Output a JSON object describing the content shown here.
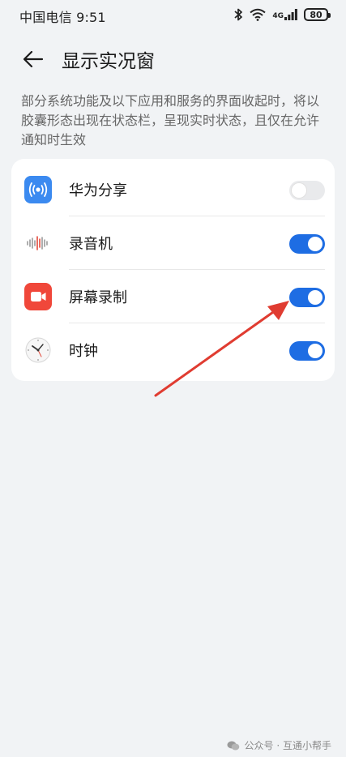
{
  "status_bar": {
    "carrier": "中国电信 9:51",
    "network": "4G",
    "battery": "80"
  },
  "header": {
    "title": "显示实况窗"
  },
  "description": "部分系统功能及以下应用和服务的界面收起时，将以胶囊形态出现在状态栏，呈现实时状态，且仅在允许通知时生效",
  "apps": [
    {
      "label": "华为分享",
      "icon": "huawei-share-icon",
      "enabled": false
    },
    {
      "label": "录音机",
      "icon": "recorder-icon",
      "enabled": true
    },
    {
      "label": "屏幕录制",
      "icon": "screen-record-icon",
      "enabled": true
    },
    {
      "label": "时钟",
      "icon": "clock-icon",
      "enabled": true
    }
  ],
  "colors": {
    "toggle_on": "#1e6de3",
    "annotation_arrow": "#e03c31"
  },
  "watermark": "公众号 · 互通小帮手"
}
